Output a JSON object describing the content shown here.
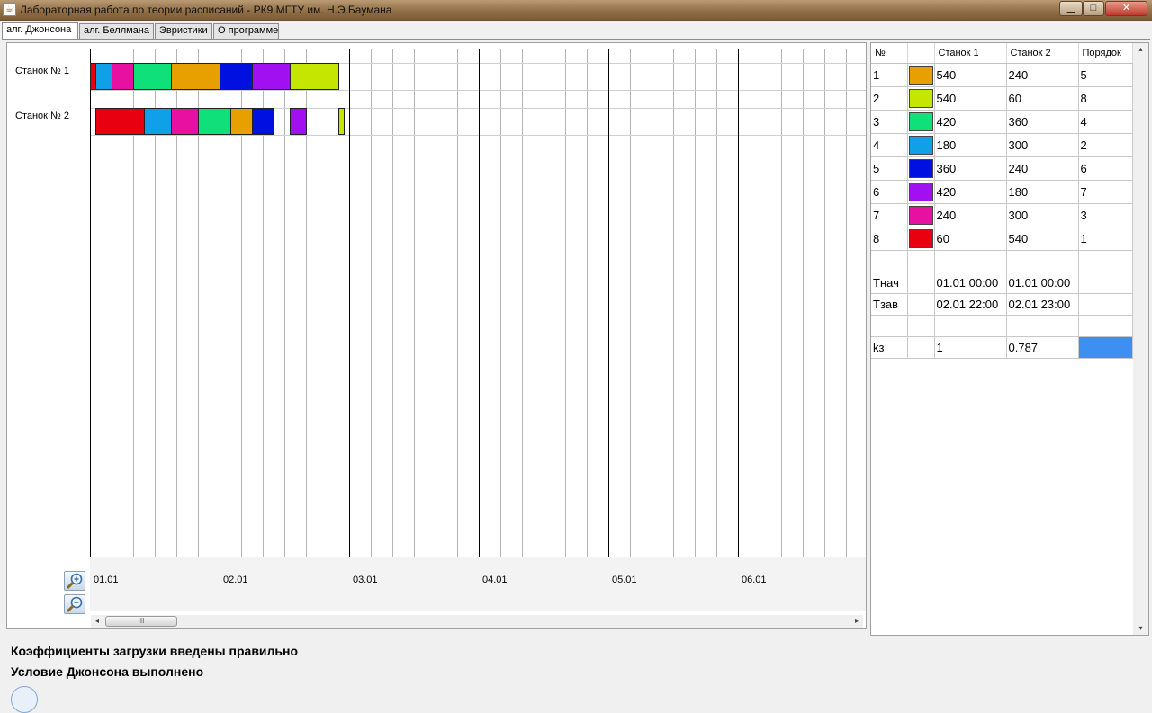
{
  "window": {
    "title": "Лабораторная работа по теории расписаний  -  РК9 МГТУ им. Н.Э.Баумана",
    "icon": "java-cup-icon",
    "controls": {
      "minimize": "▁",
      "maximize": "□",
      "close": "✕"
    }
  },
  "tabs": [
    {
      "label": "алг. Джонсона",
      "active": true
    },
    {
      "label": "алг. Беллмана",
      "active": false
    },
    {
      "label": "Эвристики",
      "active": false
    },
    {
      "label": "О программе",
      "active": false
    }
  ],
  "gantt": {
    "machines": [
      "Станок № 1",
      "Станок № 2"
    ],
    "zoom_in_icon": "zoom-in-icon",
    "zoom_out_icon": "zoom-out-icon"
  },
  "scroll": {
    "left": "◂",
    "right": "▸",
    "up": "▴",
    "down": "▾",
    "grip": "III"
  },
  "chart_data": {
    "type": "gantt",
    "x_unit": "hours from 01.01 00:00",
    "xlim": [
      0,
      144
    ],
    "major_ticks": [
      {
        "hours": 0,
        "label": "01.01"
      },
      {
        "hours": 24,
        "label": "02.01"
      },
      {
        "hours": 48,
        "label": "03.01"
      },
      {
        "hours": 72,
        "label": "04.01"
      },
      {
        "hours": 96,
        "label": "05.01"
      },
      {
        "hours": 120,
        "label": "06.01"
      }
    ],
    "minor_step_hours": 4,
    "rows": [
      {
        "machine": "Станок № 1",
        "bars": [
          {
            "job": 8,
            "start": 0,
            "end": 1
          },
          {
            "job": 4,
            "start": 1,
            "end": 4
          },
          {
            "job": 7,
            "start": 4,
            "end": 8
          },
          {
            "job": 3,
            "start": 8,
            "end": 15
          },
          {
            "job": 1,
            "start": 15,
            "end": 24
          },
          {
            "job": 5,
            "start": 24,
            "end": 30
          },
          {
            "job": 6,
            "start": 30,
            "end": 37
          },
          {
            "job": 2,
            "start": 37,
            "end": 46
          }
        ]
      },
      {
        "machine": "Станок № 2",
        "bars": [
          {
            "job": 8,
            "start": 1,
            "end": 10
          },
          {
            "job": 4,
            "start": 10,
            "end": 15
          },
          {
            "job": 7,
            "start": 15,
            "end": 20
          },
          {
            "job": 3,
            "start": 20,
            "end": 26
          },
          {
            "job": 1,
            "start": 26,
            "end": 30
          },
          {
            "job": 5,
            "start": 30,
            "end": 34
          },
          {
            "job": 6,
            "start": 37,
            "end": 40
          },
          {
            "job": 2,
            "start": 46,
            "end": 47
          }
        ]
      }
    ]
  },
  "table": {
    "headers": [
      "№",
      "",
      "Станок 1",
      "Станок 2",
      "Порядок"
    ],
    "jobs": [
      {
        "n": "1",
        "color": "#e8a000",
        "m1": "540",
        "m2": "240",
        "order": "5"
      },
      {
        "n": "2",
        "color": "#c4e600",
        "m1": "540",
        "m2": "60",
        "order": "8"
      },
      {
        "n": "3",
        "color": "#10e07a",
        "m1": "420",
        "m2": "360",
        "order": "4"
      },
      {
        "n": "4",
        "color": "#10a0e8",
        "m1": "180",
        "m2": "300",
        "order": "2"
      },
      {
        "n": "5",
        "color": "#0010e0",
        "m1": "360",
        "m2": "240",
        "order": "6"
      },
      {
        "n": "6",
        "color": "#a010f0",
        "m1": "420",
        "m2": "180",
        "order": "7"
      },
      {
        "n": "7",
        "color": "#e810a0",
        "m1": "240",
        "m2": "300",
        "order": "3"
      },
      {
        "n": "8",
        "color": "#e80010",
        "m1": "60",
        "m2": "540",
        "order": "1"
      }
    ],
    "tstart": {
      "label": "Тнач",
      "m1": "01.01 00:00",
      "m2": "01.01 00:00"
    },
    "tend": {
      "label": "Тзав",
      "m1": "02.01 22:00",
      "m2": "02.01 23:00"
    },
    "kz": {
      "label": "kз",
      "m1": "1",
      "m2": "0.787"
    },
    "selected_color": "#3d8ff2"
  },
  "status": {
    "line1": "Коэффициенты загрузки введены правильно",
    "line2": "Условие Джонсона выполнено"
  }
}
